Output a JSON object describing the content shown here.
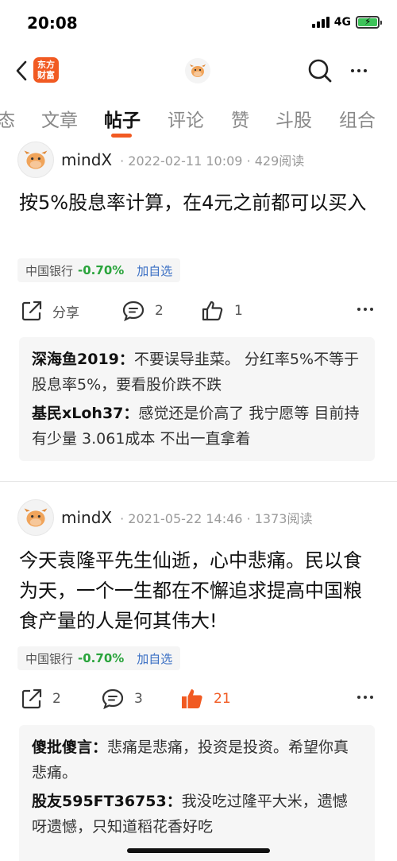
{
  "status": {
    "time": "20:08",
    "network": "4G"
  },
  "nav": {
    "logo_line1": "东方",
    "logo_line2": "财富"
  },
  "tabs": [
    {
      "label": "态"
    },
    {
      "label": "文章"
    },
    {
      "label": "帖子"
    },
    {
      "label": "评论"
    },
    {
      "label": "赞"
    },
    {
      "label": "斗股"
    },
    {
      "label": "组合"
    }
  ],
  "posts": [
    {
      "author": "mindX",
      "meta": "· 2022-02-11 10:09 · 429阅读",
      "text": "按5%股息率计算，在4元之前都可以买入",
      "stock": {
        "name": "中国银行",
        "change": "-0.70%",
        "add": "加自选"
      },
      "share": "分享",
      "comments_count": "2",
      "likes": "1",
      "comments": [
        {
          "user": "深海鱼2019：",
          "text": "不要误导韭菜。 分红率5%不等于股息率5%，要看股价跌不跌"
        },
        {
          "user": "基民xLoh37：",
          "text": "感觉还是价高了 我宁愿等 目前持有少量 3.061成本 不出一直拿着"
        }
      ]
    },
    {
      "author": "mindX",
      "meta": "· 2021-05-22 14:46 · 1373阅读",
      "text": "今天袁隆平先生仙逝，心中悲痛。民以食为天，一个一生都在不懈追求提高中国粮食产量的人是何其伟大!",
      "stock": {
        "name": "中国银行",
        "change": "-0.70%",
        "add": "加自选"
      },
      "share": "2",
      "comments_count": "3",
      "likes": "21",
      "comments": [
        {
          "user": "傻批傻言：",
          "text": "悲痛是悲痛，投资是投资。希望你真悲痛。"
        },
        {
          "user": "股友595FT36753：",
          "text": "我没吃过隆平大米，遗憾呀遗憾，只知道稻花香好吃"
        }
      ]
    }
  ],
  "colors": {
    "accent": "#f15a22",
    "down": "#2aa43c",
    "link": "#3a6fc4"
  }
}
